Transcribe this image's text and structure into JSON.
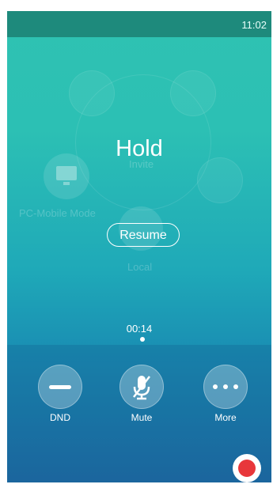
{
  "status_bar": {
    "time": "11:02"
  },
  "call": {
    "state_title": "Hold",
    "resume_label": "Resume",
    "duration": "00:14"
  },
  "background_menu": {
    "invite_label": "Invite",
    "pc_mobile_label": "PC-Mobile Mode",
    "local_label": "Local"
  },
  "actions": [
    {
      "label": "DND",
      "icon": "dnd-icon"
    },
    {
      "label": "Mute",
      "icon": "mic-off-icon"
    },
    {
      "label": "More",
      "icon": "more-icon"
    }
  ],
  "colors": {
    "accent_record": "#e8373b",
    "status_bar": "#1e8a7c"
  }
}
